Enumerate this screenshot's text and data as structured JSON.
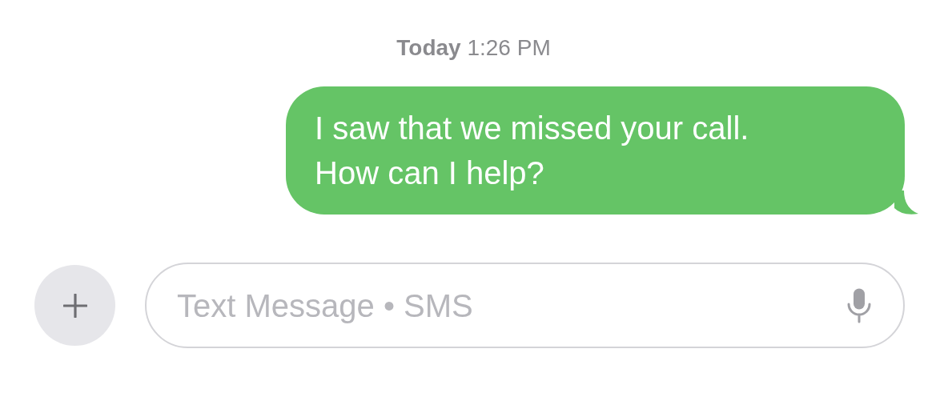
{
  "timestamp": "**Today** 1:26 PM",
  "messages": [
    {
      "text": "I saw that we missed your call. How can I help?",
      "kind": "outgoing"
    }
  ],
  "composer": {
    "placeholder": "Text Message • SMS"
  }
}
